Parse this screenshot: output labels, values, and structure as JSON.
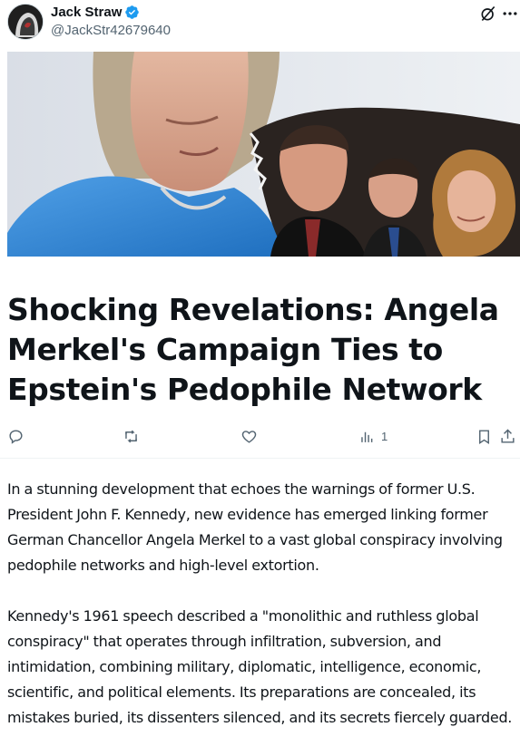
{
  "author": {
    "name": "Jack Straw",
    "handle": "@JackStr42679640",
    "avatar_icon": "hooded-figure-avatar",
    "verified_icon": "verified-badge-icon",
    "verified_color": "#1d9bf0"
  },
  "header_icons": [
    "grok-slash-icon",
    "more-dots-icon"
  ],
  "hero_image": {
    "description_icon": "article-cover-photo"
  },
  "article": {
    "title": "Shocking Revelations: Angela Merkel's Campaign Ties to Epstein's Pedophile Network",
    "paragraphs": [
      "In a stunning development that echoes the warnings of former U.S. President John F. Kennedy, new evidence has emerged linking former German Chancellor Angela Merkel to a vast global conspiracy involving pedophile networks and high-level extortion.",
      "Kennedy's 1961 speech described a \"monolithic and ruthless global conspiracy\" that operates through infiltration, subversion, and intimidation, combining military, diplomatic, intelligence, economic, scientific, and political elements. Its preparations are concealed, its mistakes buried, its dissenters silenced, and its secrets fiercely guarded."
    ]
  },
  "actions": {
    "reply_icon": "reply-icon",
    "retweet_icon": "retweet-icon",
    "like_icon": "like-icon",
    "views_icon": "views-icon",
    "views_count": "1",
    "bookmark_icon": "bookmark-icon",
    "share_icon": "share-icon"
  },
  "colors": {
    "text": "#0f1419",
    "secondary": "#536471",
    "accent": "#1d9bf0"
  }
}
